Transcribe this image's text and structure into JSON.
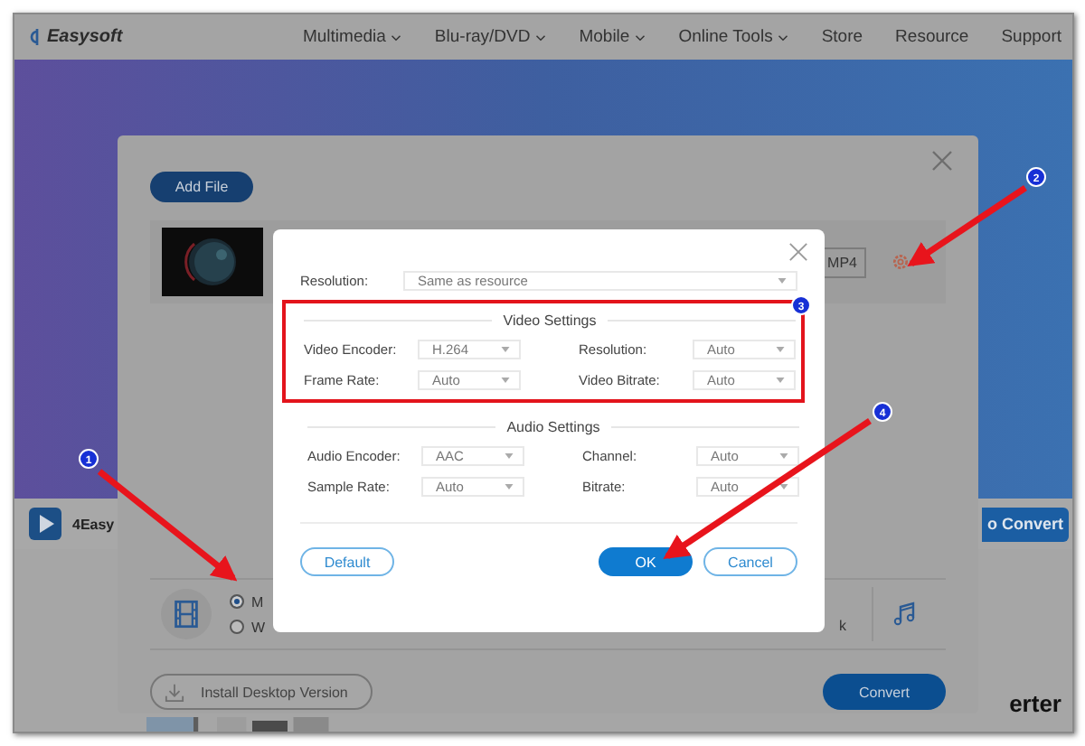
{
  "nav": {
    "logo": "Easysoft",
    "items": [
      {
        "label": "Multimedia",
        "dropdown": true
      },
      {
        "label": "Blu-ray/DVD",
        "dropdown": true
      },
      {
        "label": "Mobile",
        "dropdown": true
      },
      {
        "label": "Online Tools",
        "dropdown": true
      },
      {
        "label": "Store",
        "dropdown": false
      },
      {
        "label": "Resource",
        "dropdown": false
      },
      {
        "label": "Support",
        "dropdown": false
      }
    ]
  },
  "strip": {
    "brand": "4Easy",
    "button": "o Convert"
  },
  "heading": "erter",
  "converter": {
    "add_button": "Add File",
    "file": {
      "format": "MP4"
    },
    "formats": [
      {
        "label": "M",
        "selected": true
      },
      {
        "label": "W",
        "selected": false
      }
    ],
    "format_tail": "k",
    "install_button": "Install Desktop Version",
    "convert_button": "Convert"
  },
  "dialog": {
    "resolution": {
      "label": "Resolution:",
      "value": "Same as resource"
    },
    "sections": [
      {
        "title": "Video Settings",
        "highlighted": true,
        "fields": [
          {
            "label": "Video Encoder:",
            "value": "H.264"
          },
          {
            "label": "Resolution:",
            "value": "Auto"
          },
          {
            "label": "Frame Rate:",
            "value": "Auto"
          },
          {
            "label": "Video Bitrate:",
            "value": "Auto"
          }
        ]
      },
      {
        "title": "Audio Settings",
        "highlighted": false,
        "fields": [
          {
            "label": "Audio Encoder:",
            "value": "AAC"
          },
          {
            "label": "Channel:",
            "value": "Auto"
          },
          {
            "label": "Sample Rate:",
            "value": "Auto"
          },
          {
            "label": "Bitrate:",
            "value": "Auto"
          }
        ]
      }
    ],
    "buttons": [
      {
        "label": "Default",
        "kind": "outline"
      },
      {
        "label": "OK",
        "kind": "primary"
      },
      {
        "label": "Cancel",
        "kind": "outline"
      }
    ]
  },
  "annotations": [
    {
      "number": "1"
    },
    {
      "number": "2"
    },
    {
      "number": "3"
    },
    {
      "number": "4"
    }
  ]
}
